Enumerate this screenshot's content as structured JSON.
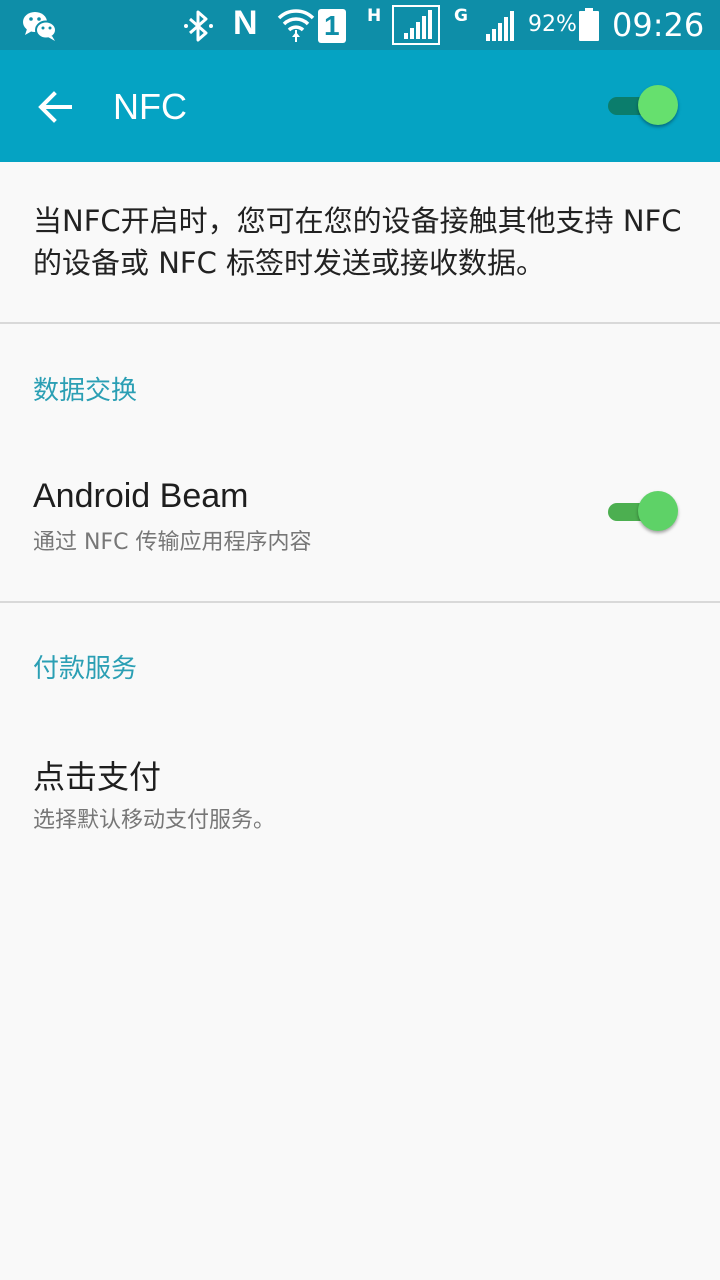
{
  "status_bar": {
    "battery_percent": "92%",
    "time": "09:26",
    "network_h": "H",
    "network_g": "G",
    "sim_number": "1",
    "nfc_letter": "N",
    "icons": [
      "wechat-icon",
      "bluetooth-icon",
      "nfc-icon",
      "wifi-icon",
      "sim1-icon",
      "signal-icon",
      "battery-icon"
    ]
  },
  "app_bar": {
    "title": "NFC",
    "nfc_enabled": true
  },
  "description": "当NFC开启时，您可在您的设备接触其他支持 NFC 的设备或 NFC 标签时发送或接收数据。",
  "sections": {
    "data_exchange": {
      "header": "数据交换",
      "android_beam": {
        "title": "Android Beam",
        "subtitle": "通过 NFC 传输应用程序内容",
        "enabled": true
      }
    },
    "payment": {
      "header": "付款服务",
      "tap_and_pay": {
        "title": "点击支付",
        "subtitle": "选择默认移动支付服务。"
      }
    }
  },
  "colors": {
    "status_bar": "#0e8ea8",
    "app_bar": "#05a3c3",
    "accent": "#2b9fb4",
    "switch_thumb_main": "#66e06e",
    "switch_track_main": "#0b7d6c",
    "switch_thumb": "#5ed267",
    "switch_track": "#4caf50"
  }
}
